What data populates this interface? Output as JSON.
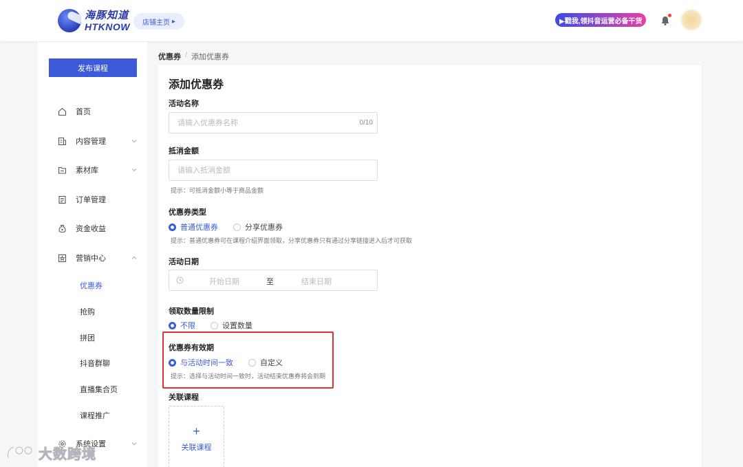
{
  "header": {
    "logo_cn": "海豚知道",
    "logo_en": "HTKNOW",
    "shop_home": "店铺主页",
    "promo": "▶戳我,领抖音运营必备干货"
  },
  "sidebar": {
    "publish_button": "发布课程",
    "items": [
      {
        "label": "首页",
        "icon": "home-icon"
      },
      {
        "label": "内容管理",
        "icon": "content-icon"
      },
      {
        "label": "素材库",
        "icon": "folder-icon"
      },
      {
        "label": "订单管理",
        "icon": "order-icon"
      },
      {
        "label": "资金收益",
        "icon": "money-bag-icon"
      },
      {
        "label": "营销中心",
        "icon": "marketing-icon"
      },
      {
        "label": "系统设置",
        "icon": "settings-icon"
      }
    ],
    "marketing_sub": [
      "优惠券",
      "抢购",
      "拼团",
      "抖音群聊",
      "直播集合页",
      "课程推广"
    ]
  },
  "breadcrumb": {
    "parent": "优惠券",
    "separator": "/",
    "current": "添加优惠券"
  },
  "form": {
    "title": "添加优惠券",
    "name": {
      "label": "活动名称",
      "placeholder": "请输入优惠券名称",
      "counter": "0/10"
    },
    "amount": {
      "label": "抵消金额",
      "placeholder": "请输入抵消金额",
      "hint": "提示：可抵消金额小等于商品金额"
    },
    "type": {
      "label": "优惠券类型",
      "options": [
        "普通优惠券",
        "分享优惠券"
      ],
      "hint": "提示：普通优惠券可在课程介绍界面领取，分享优惠券只有通过分享链接进入后才可获取"
    },
    "date": {
      "label": "活动日期",
      "start_placeholder": "开始日期",
      "separator": "至",
      "end_placeholder": "结束日期"
    },
    "limit": {
      "label": "领取数量限制",
      "options": [
        "不限",
        "设置数量"
      ]
    },
    "validity": {
      "label": "优惠券有效期",
      "options": [
        "与活动时间一致",
        "自定义"
      ],
      "hint": "提示：选择与活动时间一致时，活动结束优惠券将会到期"
    },
    "course": {
      "label": "关联课程",
      "plus": "+",
      "button": "关联课程"
    }
  },
  "watermark": "大数跨境",
  "colors": {
    "accent": "#3d5bd9",
    "highlight": "#e03131"
  }
}
